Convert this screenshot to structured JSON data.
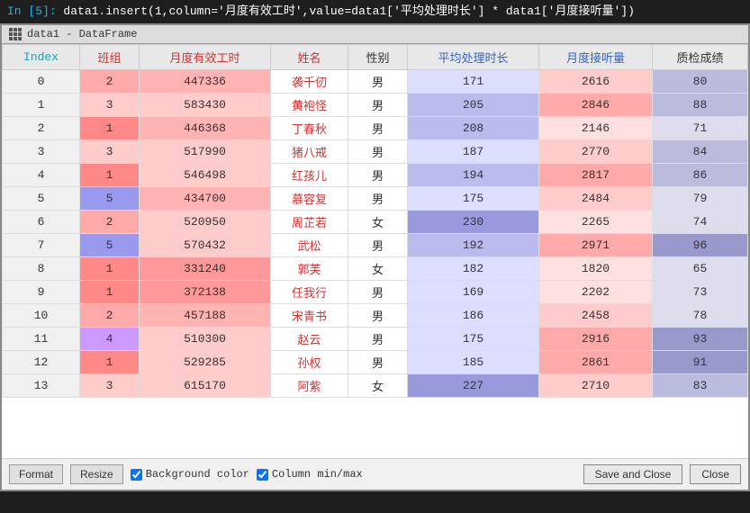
{
  "topbar": {
    "prompt": "In [5]:",
    "code": " data1.insert(1,column='月度有效工时',value=data1['平均处理时长'] * data1['月度接听量'])"
  },
  "window": {
    "title": "data1 - DataFrame"
  },
  "table": {
    "headers": [
      "Index",
      "班组",
      "月度有效工时",
      "姓名",
      "性别",
      "平均处理时长",
      "月度接听量",
      "质检成绩"
    ],
    "rows": [
      {
        "index": 0,
        "banz": 2,
        "gongshi": 447336,
        "name": "袭千仞",
        "gender": "男",
        "avg": 171,
        "listen": 2616,
        "score": 80
      },
      {
        "index": 1,
        "banz": 3,
        "gongshi": 583430,
        "name": "黄袍怪",
        "gender": "男",
        "avg": 205,
        "listen": 2846,
        "score": 88
      },
      {
        "index": 2,
        "banz": 1,
        "gongshi": 446368,
        "name": "丁春秋",
        "gender": "男",
        "avg": 208,
        "listen": 2146,
        "score": 71
      },
      {
        "index": 3,
        "banz": 3,
        "gongshi": 517990,
        "name": "猪八戒",
        "gender": "男",
        "avg": 187,
        "listen": 2770,
        "score": 84
      },
      {
        "index": 4,
        "banz": 1,
        "gongshi": 546498,
        "name": "红孩儿",
        "gender": "男",
        "avg": 194,
        "listen": 2817,
        "score": 86
      },
      {
        "index": 5,
        "banz": 5,
        "gongshi": 434700,
        "name": "慕容复",
        "gender": "男",
        "avg": 175,
        "listen": 2484,
        "score": 79
      },
      {
        "index": 6,
        "banz": 2,
        "gongshi": 520950,
        "name": "周芷若",
        "gender": "女",
        "avg": 230,
        "listen": 2265,
        "score": 74
      },
      {
        "index": 7,
        "banz": 5,
        "gongshi": 570432,
        "name": "武松",
        "gender": "男",
        "avg": 192,
        "listen": 2971,
        "score": 96
      },
      {
        "index": 8,
        "banz": 1,
        "gongshi": 331240,
        "name": "郭芙",
        "gender": "女",
        "avg": 182,
        "listen": 1820,
        "score": 65
      },
      {
        "index": 9,
        "banz": 1,
        "gongshi": 372138,
        "name": "任我行",
        "gender": "男",
        "avg": 169,
        "listen": 2202,
        "score": 73
      },
      {
        "index": 10,
        "banz": 2,
        "gongshi": 457188,
        "name": "宋青书",
        "gender": "男",
        "avg": 186,
        "listen": 2458,
        "score": 78
      },
      {
        "index": 11,
        "banz": 4,
        "gongshi": 510300,
        "name": "赵云",
        "gender": "男",
        "avg": 175,
        "listen": 2916,
        "score": 93
      },
      {
        "index": 12,
        "banz": 1,
        "gongshi": 529285,
        "name": "孙权",
        "gender": "男",
        "avg": 185,
        "listen": 2861,
        "score": 91
      },
      {
        "index": 13,
        "banz": 3,
        "gongshi": 615170,
        "name": "阿紫",
        "gender": "女",
        "avg": 227,
        "listen": 2710,
        "score": 83
      }
    ]
  },
  "toolbar": {
    "format_label": "Format",
    "resize_label": "Resize",
    "bg_color_label": "Background color",
    "col_minmax_label": "Column min/max",
    "save_close_label": "Save and Close",
    "close_label": "Close"
  }
}
